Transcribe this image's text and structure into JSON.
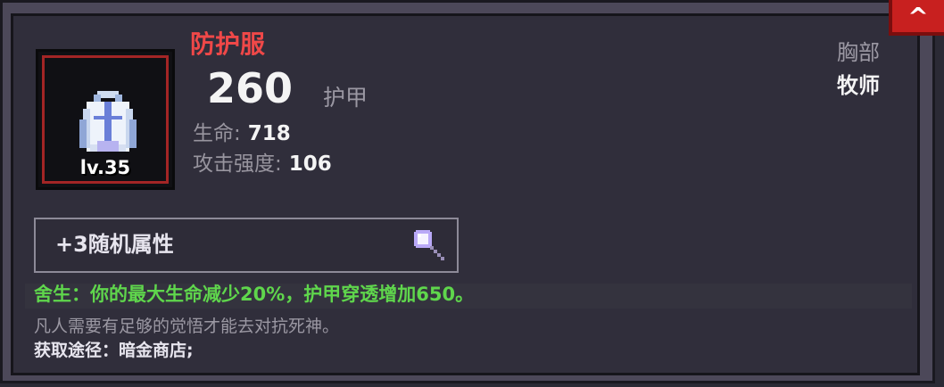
{
  "item": {
    "name": "防护服",
    "level": "lv.35",
    "armor_value": "260",
    "armor_label": "护甲",
    "slot": "胸部",
    "class": "牧师",
    "icon": "protective-suit-icon"
  },
  "stats": [
    {
      "label": "生命:",
      "value": "718"
    },
    {
      "label": "攻击强度:",
      "value": "106"
    }
  ],
  "random_attributes": {
    "label": "+3随机属性",
    "icon": "magnifier-icon"
  },
  "effect": "舍生：你的最大生命减少20%，护甲穿透增加650。",
  "flavor": "凡人需要有足够的觉悟才能去对抗死神。",
  "source": "获取途径：暗金商店;",
  "colors": {
    "item_name": "#ef4848",
    "effect": "#5fd64c",
    "frame_border": "#a32525",
    "close_button": "#c8201f"
  },
  "close_icon": "close-icon"
}
